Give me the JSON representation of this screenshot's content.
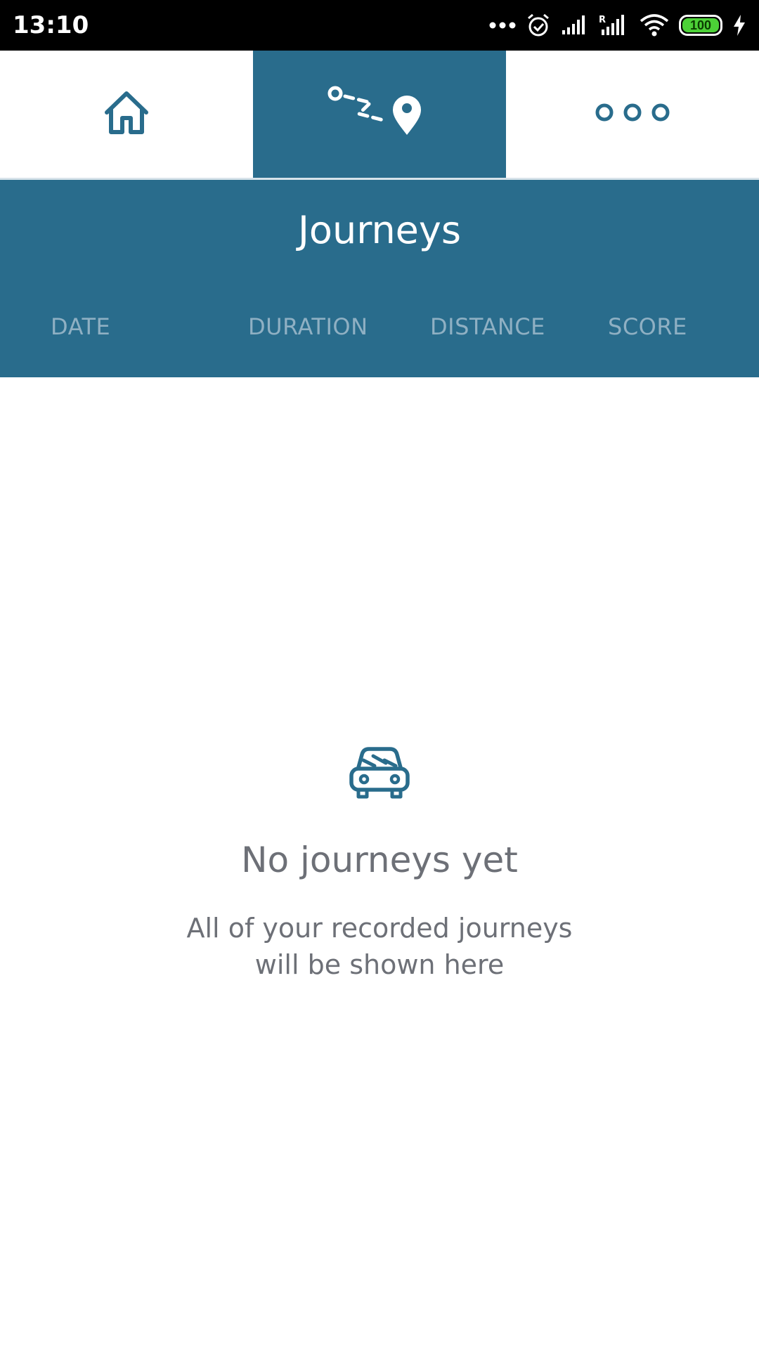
{
  "status_bar": {
    "time": "13:10",
    "battery_level": "100",
    "icons": [
      "more-dots-icon",
      "alarm-icon",
      "signal-icon",
      "signal-roaming-icon",
      "wifi-icon",
      "battery-icon",
      "charging-icon"
    ]
  },
  "nav": {
    "items": [
      {
        "name": "home",
        "icon": "home-icon",
        "active": false
      },
      {
        "name": "journeys",
        "icon": "route-icon",
        "active": true
      },
      {
        "name": "more",
        "icon": "more-icon",
        "active": false
      }
    ]
  },
  "header": {
    "title": "Journeys",
    "columns": [
      "DATE",
      "DURATION",
      "DISTANCE",
      "SCORE"
    ]
  },
  "empty_state": {
    "icon": "car-icon",
    "title": "No journeys yet",
    "subtitle": "All of your recorded journeys\nwill be shown here"
  },
  "colors": {
    "primary": "#296c8c",
    "column_header": "#8fb0c3",
    "muted_text": "#6d7077",
    "battery": "#4cd137"
  }
}
